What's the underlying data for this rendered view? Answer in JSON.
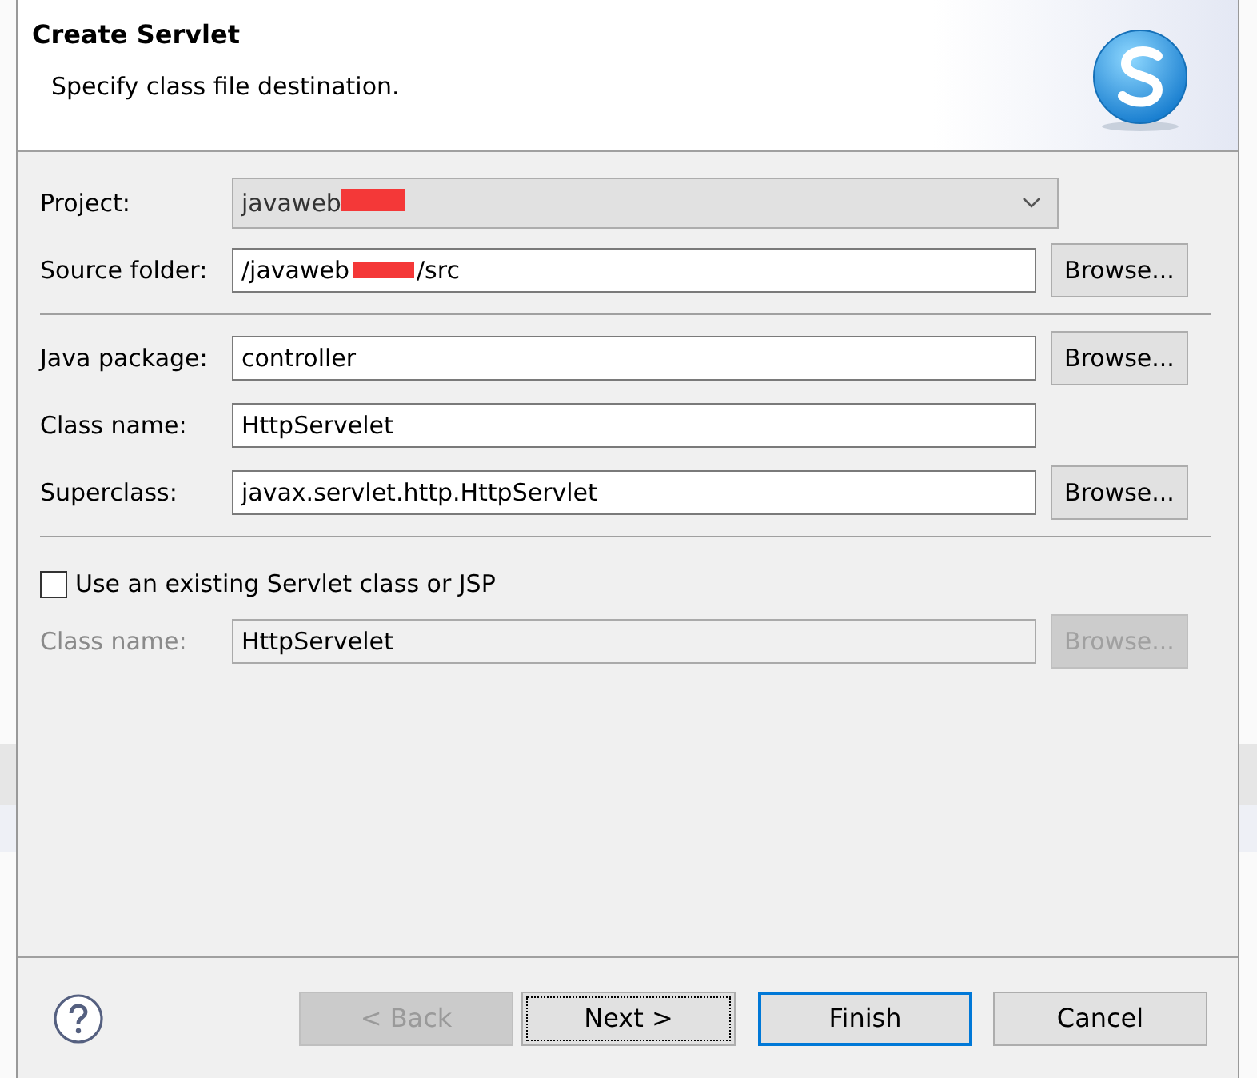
{
  "dialog": {
    "title": "Create Servlet",
    "subtitle": "Specify class file destination.",
    "project": {
      "label": "Project:",
      "value": "javaweb",
      "disabled": true
    },
    "source_folder": {
      "label": "Source folder:",
      "value_start": "/javaweb",
      "value_end": "/src",
      "button": "Browse..."
    },
    "fields": [
      {
        "label": "Java package:",
        "value": "controller",
        "button": "Browse..."
      },
      {
        "label": "Class name:",
        "value": "HttpServelet"
      },
      {
        "label": "Superclass:",
        "value": "javax.servlet.http.HttpServlet",
        "button": "Browse..."
      }
    ],
    "existing": {
      "label": "Use an existing Servlet class or JSP",
      "checked": false
    },
    "existing_class": {
      "label": "Class name:",
      "value": "HttpServelet",
      "button": "Browse...",
      "disabled": true
    },
    "buttons": [
      {
        "label": "< Back",
        "disabled": true,
        "kind": "normal"
      },
      {
        "label": "Next >",
        "disabled": false,
        "kind": "focused"
      },
      {
        "label": "Finish",
        "disabled": false,
        "kind": "default"
      },
      {
        "label": "Cancel",
        "disabled": false,
        "kind": "normal"
      }
    ]
  }
}
